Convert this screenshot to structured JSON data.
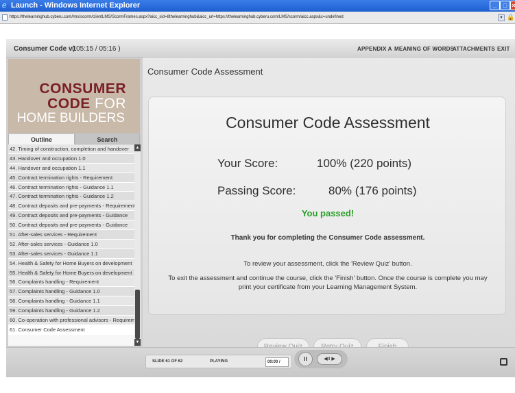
{
  "browser": {
    "title": "Launch - Windows Internet Explorer",
    "url": "https://thelearninghub.cyberu.com/lms/scorm/clientLMS/ScormFrames.aspx?aicc_sid=8thelearninghub&aicc_url=https://thelearninghub.cyberu.com/LMS/scorm/aicc.aspx&c=undefined",
    "minimize_icon": "minimize-icon",
    "maximize_icon": "maximize-icon",
    "close_icon": "close-icon"
  },
  "player": {
    "course_title": "Consumer Code v1",
    "course_time": "( 05:15 / 05:16 )",
    "top_links": [
      "APPENDIX A",
      "MEANING OF WORDS",
      "ATTACHMENTS",
      "EXIT"
    ]
  },
  "logo": {
    "line1": "CONSUMER",
    "line2_code": "CODE",
    "line2_for": "FOR",
    "line3": "HOME BUILDERS"
  },
  "tabs": {
    "outline": "Outline",
    "search": "Search"
  },
  "outline": {
    "items": [
      "42. Timing of construction, completion and handover",
      "43. Handover and occupation 1.0",
      "44. Handover and occupation 1.1",
      "45. Contract termination rights - Requirement",
      "46. Contract termination rights - Guidance 1.1",
      "47. Contract termination rights - Guidance 1.2",
      "48. Contract deposits and pre-payments - Requirement",
      "49. Contract deposits and pre-payments - Guidance",
      "50. Contract deposits and pre-payments - Guidance",
      "51. After-sales services - Requirement",
      "52. After-sales services - Guidance 1.0",
      "53. After-sales services - Guidance 1.1",
      "54. Health & Safety for Home Buyers on development",
      "55. Health & Safety for Home Buyers on development",
      "56. Complaints handling - Requirement",
      "57. Complaints handling - Guidance 1.0",
      "58. Complaints handling - Guidance 1.1",
      "59. Complaints handling - Guidance 1.2",
      "60. Co-operation with professional advisors - Requirement",
      "61. Consumer Code Assessment"
    ]
  },
  "content": {
    "header": "Consumer Code Assessment",
    "card_title": "Consumer Code Assessment",
    "your_score_label": "Your Score:",
    "your_score_value": "100% (220 points)",
    "passing_score_label": "Passing Score:",
    "passing_score_value": "80% (176 points)",
    "result": "You passed!",
    "thanks": "Thank you for completing the Consumer Code assessment.",
    "review_msg": "To review your assessment, click the 'Review Quiz' button.",
    "exit_msg": "To exit the assessment and continue the course, click the 'Finish' button.  Once the course is complete you may print your certificate from your Learning Management System.",
    "colors": {
      "passed": "#2aa02a"
    }
  },
  "buttons": {
    "review": "Review Quiz",
    "retry": "Retry Quiz",
    "finish": "Finish"
  },
  "playback": {
    "slide": "SLIDE 61 OF 62",
    "status": "PLAYING",
    "time": "00:00 /",
    "pause_glyph": "II",
    "nav_glyph": "◀II ▶"
  }
}
